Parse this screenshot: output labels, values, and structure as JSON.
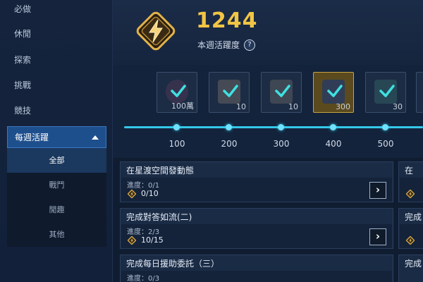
{
  "sidebar": {
    "items": [
      {
        "label": "必做"
      },
      {
        "label": "休閒"
      },
      {
        "label": "探索"
      },
      {
        "label": "挑戰"
      },
      {
        "label": "競技"
      }
    ],
    "group": {
      "label": "每週活躍",
      "sub_items": [
        {
          "label": "全部",
          "active": true
        },
        {
          "label": "戰鬥"
        },
        {
          "label": "閒趣"
        },
        {
          "label": "其他"
        }
      ]
    }
  },
  "header": {
    "score": "1244",
    "score_label": "本週活躍度",
    "help": "?"
  },
  "rewards": {
    "items": [
      {
        "qty": "100萬",
        "claimed": true,
        "icon": "coin-reward-icon"
      },
      {
        "qty": "10",
        "claimed": true,
        "icon": "material-reward-icon"
      },
      {
        "qty": "10",
        "claimed": true,
        "icon": "armor-reward-icon"
      },
      {
        "qty": "300",
        "claimed": true,
        "icon": "crystal-reward-icon"
      },
      {
        "qty": "30",
        "claimed": true,
        "icon": "chip-reward-icon"
      }
    ],
    "milestones": [
      "100",
      "200",
      "300",
      "400",
      "500"
    ],
    "track_color": "#35c8ea"
  },
  "tasks": [
    {
      "title": "在星渡空間發動態",
      "progress": "進度：0/1",
      "reward": "0/10"
    },
    {
      "title": "完成對答如流(二)",
      "progress": "進度：2/3",
      "reward": "10/15"
    },
    {
      "title": "完成每日援助委託（三）",
      "progress": "進度：0/3",
      "reward": ""
    }
  ],
  "side_cards": [
    {
      "title": "在"
    },
    {
      "title": "完成"
    },
    {
      "title": "完成"
    }
  ],
  "colors": {
    "accent_gold": "#f2c544",
    "selected_tab": "#1e4f8d",
    "check": "#3fe0e0"
  }
}
